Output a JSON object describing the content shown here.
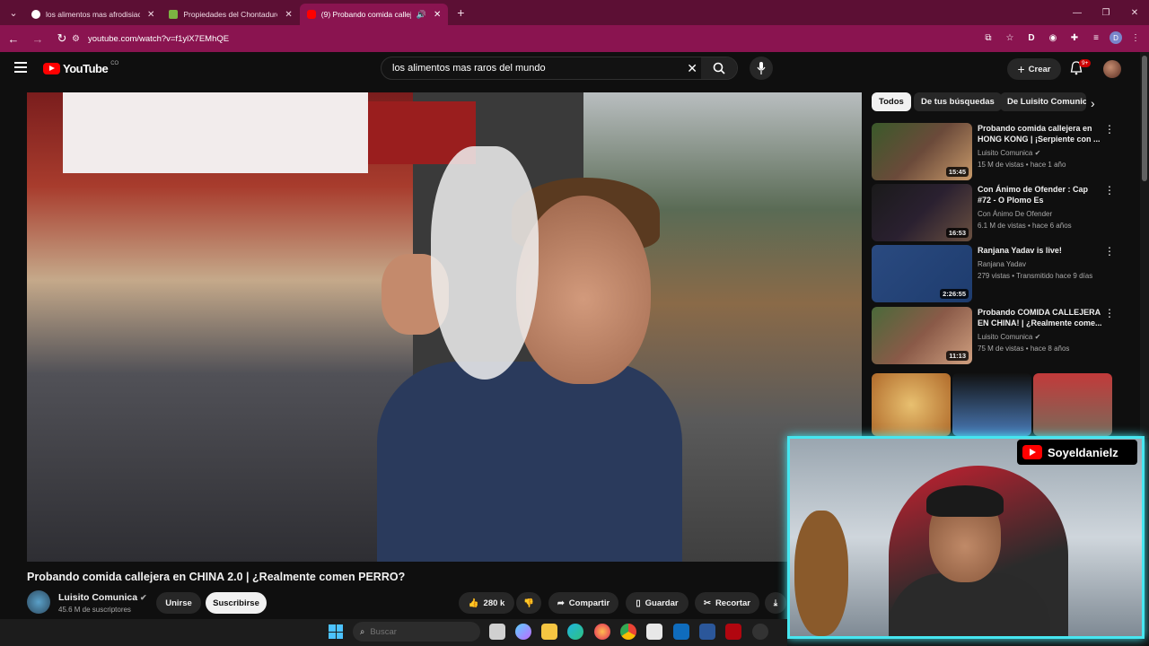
{
  "browser": {
    "tabs": [
      {
        "title": "los alimentos mas afrodisiacos",
        "favicon_color": "#ffffff"
      },
      {
        "title": "Propiedades del Chontaduro en",
        "favicon_color": "#7cb342"
      },
      {
        "title": "(9) Probando comida callejera",
        "favicon_color": "#ff0000"
      }
    ],
    "url": "youtube.com/watch?v=f1ylX7EMhQE",
    "profile_initial": "D"
  },
  "youtube": {
    "logo_text": "YouTube",
    "country": "CO",
    "search_value": "los alimentos mas raros del mundo",
    "create_label": "Crear",
    "notif_badge": "9+"
  },
  "video": {
    "title": "Probando comida callejera en CHINA 2.0 | ¿Realmente comen PERRO?",
    "channel": "Luisito Comunica",
    "subscribers": "45.6 M de suscriptores",
    "join_label": "Unirse",
    "subscribe_label": "Suscribirse",
    "likes": "280 k",
    "share_label": "Compartir",
    "save_label": "Guardar",
    "clip_label": "Recortar"
  },
  "sidebar": {
    "chips": [
      "Todos",
      "De tus búsquedas",
      "De Luisito Comunica"
    ],
    "recommendations": [
      {
        "title": "Probando comida callejera en HONG KONG | ¡Serpiente con ...",
        "channel": "Luisito Comunica",
        "meta": "15 M de vistas • hace 1 año",
        "duration": "15:45",
        "thumb_color": "#6b4a3a"
      },
      {
        "title": "Con Ánimo de Ofender : Cap #72 - O Plomo Es",
        "channel": "Con Ánimo De Ofender",
        "meta": "6.1 M de vistas • hace 6 años",
        "duration": "16:53",
        "thumb_color": "#2a2030"
      },
      {
        "title": "Ranjana Yadav is live!",
        "channel": "Ranjana Yadav",
        "meta": "279 vistas • Transmitido hace 9 días",
        "duration": "2:26:55",
        "thumb_color": "#1e3c6e"
      },
      {
        "title": "Probando COMIDA CALLEJERA EN CHINA! | ¿Realmente come...",
        "channel": "Luisito Comunica",
        "meta": "75 M de vistas • hace 8 años",
        "duration": "11:13",
        "thumb_color": "#8a5a48"
      }
    ],
    "shorts_colors": [
      "#d9a35a",
      "#4a7ab8",
      "#c23a3a"
    ]
  },
  "overlay": {
    "streamer_tag": "Soyeldanielz"
  },
  "taskbar": {
    "search_placeholder": "Buscar"
  }
}
